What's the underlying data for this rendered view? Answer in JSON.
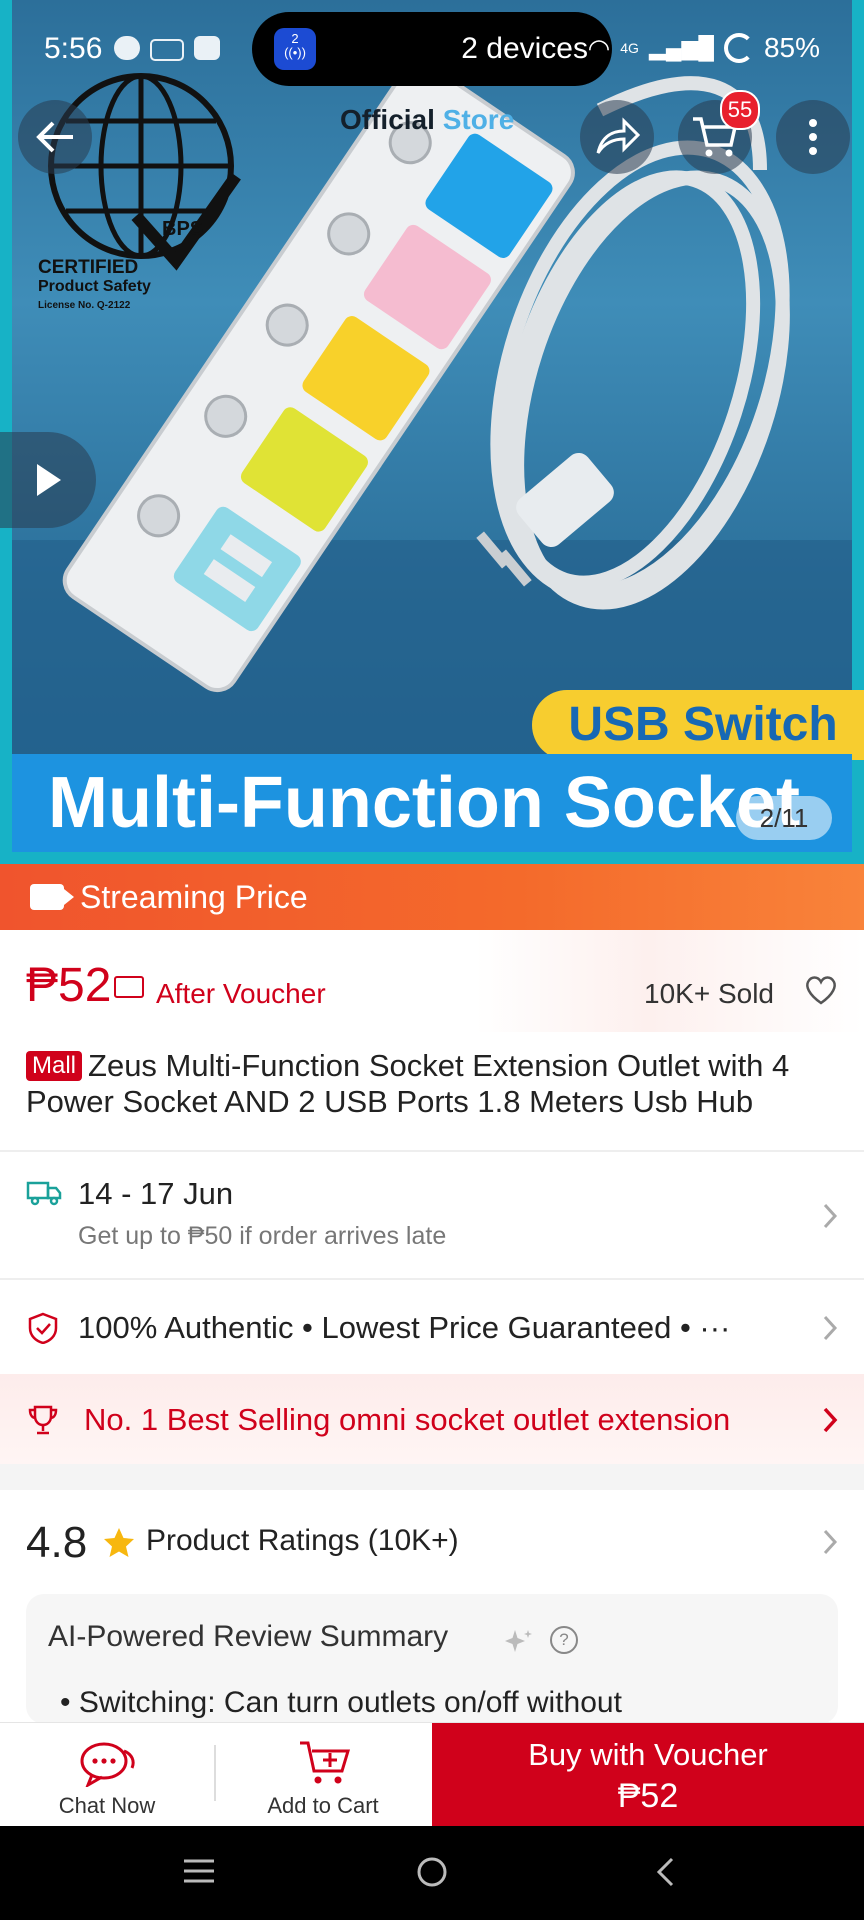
{
  "status": {
    "time": "5:56",
    "devices": "2 devices",
    "devices_badge": "2",
    "battery": "85%",
    "network": "4G"
  },
  "hero": {
    "official_store": "Official",
    "official_store_2": "Store",
    "cart_count": "55",
    "cert_line1": "CERTIFIED",
    "cert_line2": "Product Safety",
    "cert_line3": "License No. Q-2122",
    "cert_brand": "BPS",
    "usb_switch": "USB Switch",
    "banner": "Multi-Function Socket",
    "image_counter": "2/11"
  },
  "streaming": {
    "label": "Streaming Price"
  },
  "price": {
    "amount": "₱52",
    "after_voucher": "After Voucher",
    "sold": "10K+ Sold"
  },
  "product": {
    "mall_tag": "Mall",
    "title": "Zeus Multi-Function Socket Extension Outlet with 4 Power Socket AND 2 USB Ports 1.8 Meters Usb Hub"
  },
  "shipping": {
    "date": "14 - 17 Jun",
    "sub": "Get up to ₱50 if order arrives late"
  },
  "guarantee": {
    "text": "100% Authentic  •  Lowest Price Guaranteed  • ···"
  },
  "best_selling": {
    "text": "No. 1 Best Selling omni socket outlet extension"
  },
  "ratings": {
    "score": "4.8",
    "label": "Product Ratings (10K+)"
  },
  "ai_summary": {
    "title": "AI-Powered Review Summary",
    "help": "?",
    "bullet": "•  Switching: Can turn outlets on/off without"
  },
  "bottom_bar": {
    "chat": "Chat Now",
    "cart": "Add to Cart",
    "buy_line1": "Buy with Voucher",
    "buy_line2": "₱52"
  },
  "colors": {
    "accent_red": "#d0011b",
    "stream_orange": "#f46a2b",
    "teal": "#17b2c6"
  }
}
